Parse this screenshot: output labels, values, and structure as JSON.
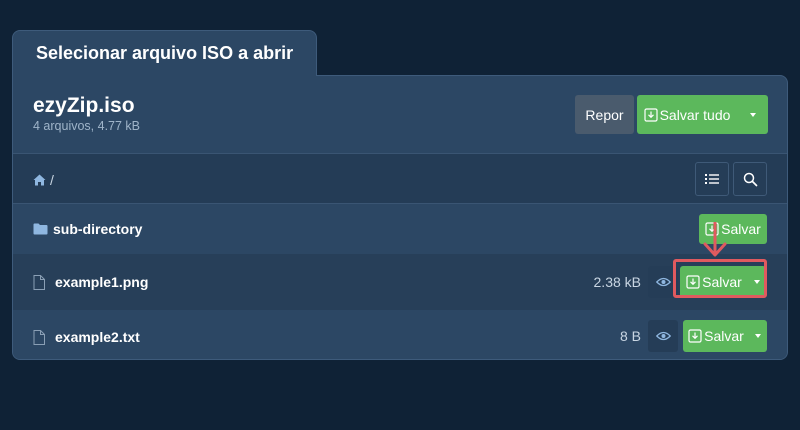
{
  "tab_title": "Selecionar arquivo ISO a abrir",
  "archive": {
    "name": "ezyZip.iso",
    "summary": "4 arquivos, 4.77 kB"
  },
  "header_buttons": {
    "reset_label": "Repor",
    "save_all_label": "Salvar tudo"
  },
  "breadcrumb": {
    "path": "/"
  },
  "rows": [
    {
      "type": "folder",
      "name": "sub-directory",
      "size": "",
      "save_label": "Salvar"
    },
    {
      "type": "file",
      "name": "example1.png",
      "size": "2.38 kB",
      "save_label": "Salvar"
    },
    {
      "type": "file",
      "name": "example2.txt",
      "size": "8 B",
      "save_label": "Salvar"
    }
  ],
  "colors": {
    "background": "#0f2236",
    "panel": "#2c4764",
    "green": "#5cb85c",
    "grey_button": "#4a5b6d",
    "highlight": "#e05a5f"
  },
  "icons": [
    "home-icon",
    "folder-icon",
    "file-icon",
    "download-icon",
    "eye-icon",
    "list-icon",
    "search-icon",
    "caret-down-icon"
  ]
}
